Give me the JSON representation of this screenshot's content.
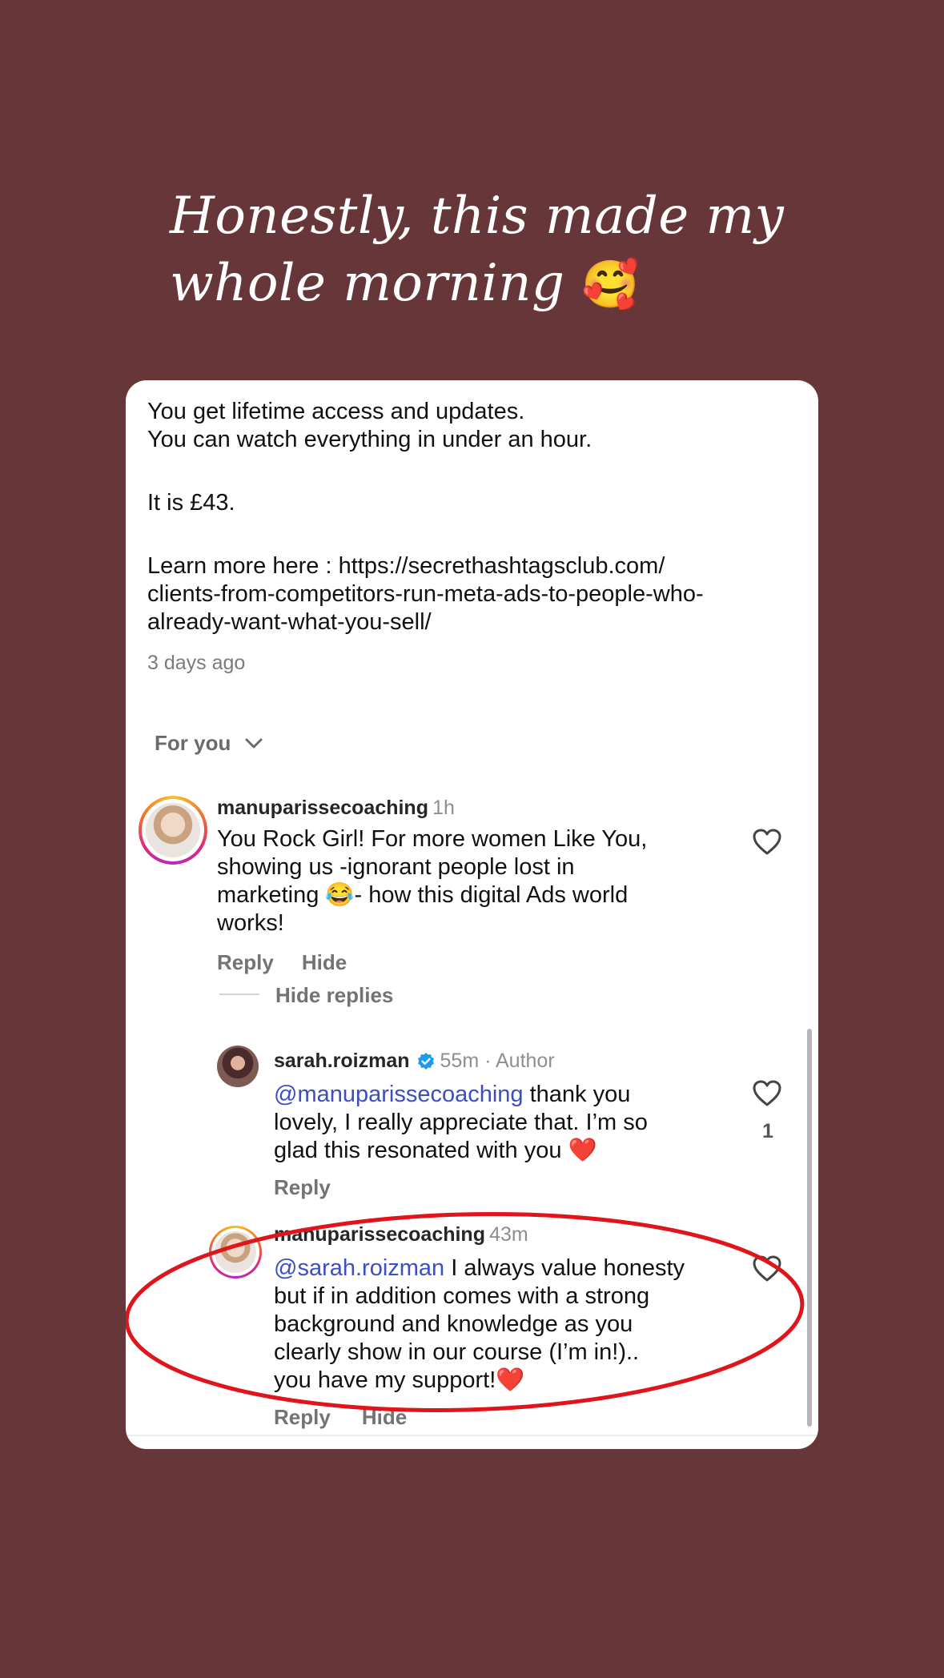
{
  "story": {
    "headline_line1": "Honestly, this made my",
    "headline_line2": "whole morning",
    "headline_emoji": "🥰"
  },
  "post": {
    "line1": "You get lifetime access and updates.",
    "line2": "You can watch everything in under an hour.",
    "line3": "It is £43.",
    "line4": "Learn more here : https://secrethashtagsclub.com/",
    "line5": "clients-from-competitors-run-meta-ads-to-people-who-",
    "line6": "already-want-what-you-sell/",
    "timestamp": "3 days ago"
  },
  "filter": {
    "label": "For you"
  },
  "comments": [
    {
      "username": "manuparissecoaching",
      "time": "1h",
      "text_lines": [
        "You Rock Girl! For more women Like You,",
        "showing us -ignorant people lost in",
        "marketing 😂- how this digital Ads world",
        "works!"
      ],
      "reply": "Reply",
      "hide": "Hide",
      "hide_replies": "Hide replies"
    },
    {
      "username": "sarah.roizman",
      "verified": true,
      "time": "55m · Author",
      "mention": "@manuparissecoaching",
      "text_lines": [
        " thank you",
        "lovely, I really appreciate that. I’m so",
        "glad this resonated with you ❤️"
      ],
      "like_count": "1",
      "reply": "Reply"
    },
    {
      "username": "manuparissecoaching",
      "time": "43m",
      "mention": "@sarah.roizman",
      "text_lines": [
        " I always value honesty",
        "but if in addition comes with a strong",
        "background and knowledge as you",
        "clearly show in our course (I’m in!)..",
        "you have my support!❤️"
      ],
      "reply": "Reply",
      "hide": "Hide"
    }
  ],
  "colors": {
    "background": "#673638",
    "card": "#ffffff",
    "mention": "#3b4ec2",
    "annotation": "#e0141b",
    "verified": "#1d9bf0"
  }
}
